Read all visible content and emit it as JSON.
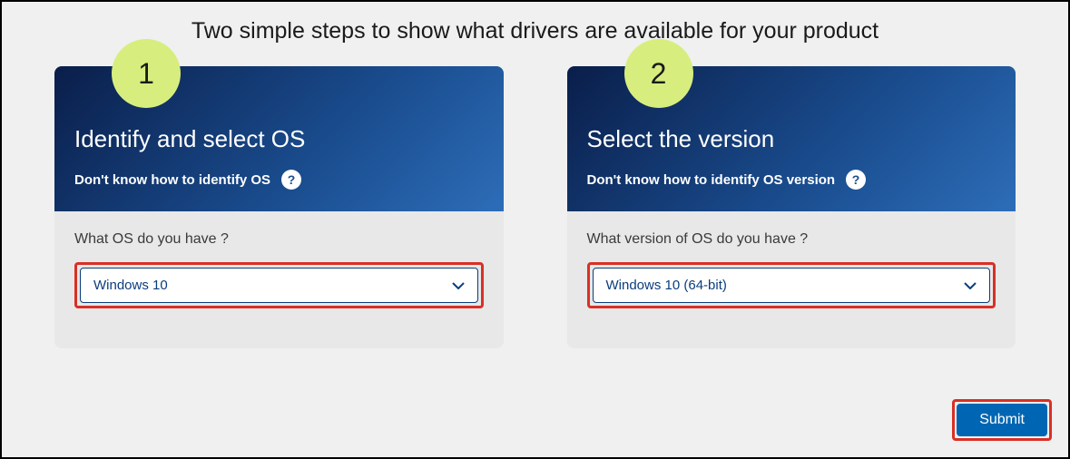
{
  "page_title": "Two simple steps to show what drivers are available for your product",
  "steps": [
    {
      "number": "1",
      "title": "Identify and select OS",
      "help_text": "Don't know how to identify OS",
      "question": "What OS do you have ?",
      "selected_value": "Windows 10"
    },
    {
      "number": "2",
      "title": "Select the version",
      "help_text": "Don't know how to identify OS version",
      "question": "What version of OS do you have ?",
      "selected_value": "Windows 10 (64-bit)"
    }
  ],
  "submit_label": "Submit"
}
